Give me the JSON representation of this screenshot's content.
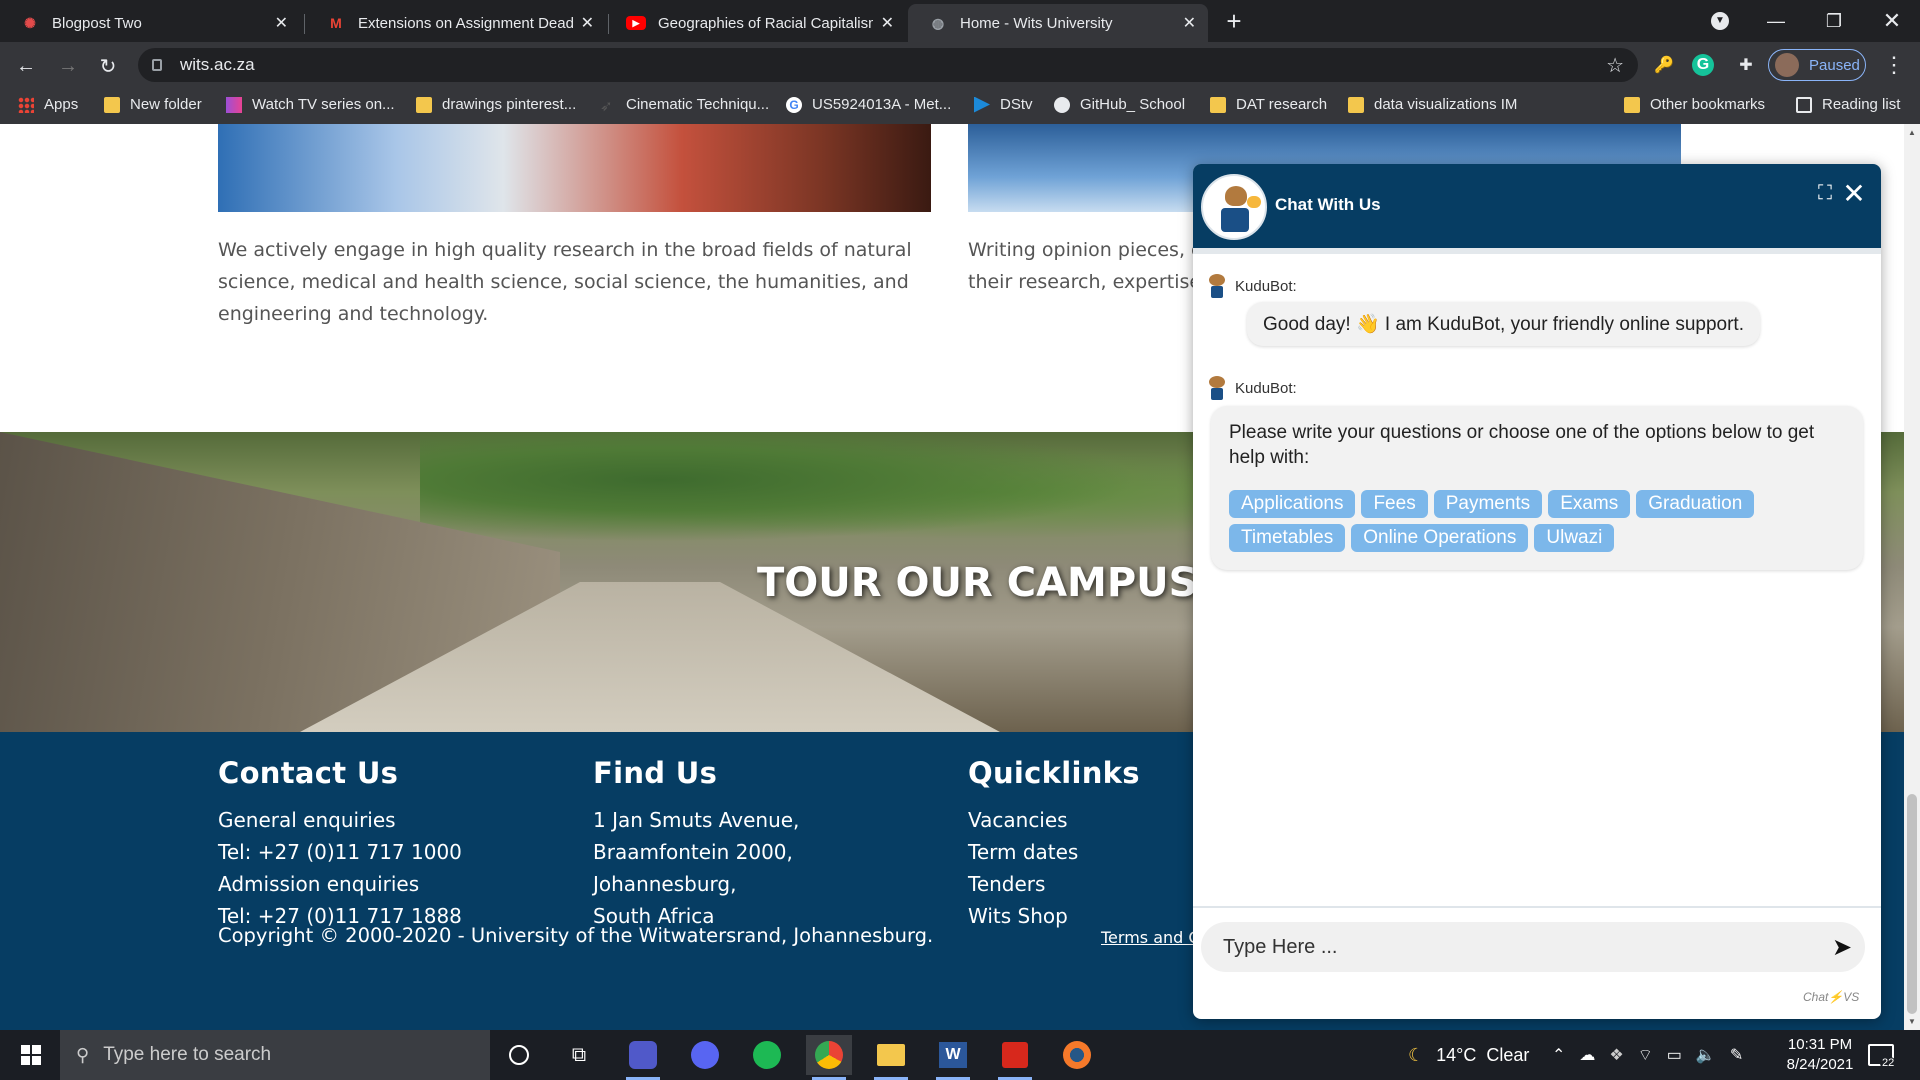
{
  "browser": {
    "tabs": [
      {
        "title": "Blogpost Two",
        "icon": "blogger-icon",
        "color": "#e34b4b"
      },
      {
        "title": "Extensions on Assignment Deadl",
        "icon": "gmail-icon",
        "color": "#ea4335"
      },
      {
        "title": "Geographies of Racial Capitalism",
        "icon": "youtube-icon",
        "color": "#ff0000"
      },
      {
        "title": "Home - Wits University",
        "icon": "globe-icon",
        "color": "#9aa0a6"
      }
    ],
    "url": "wits.ac.za",
    "profile_label": "Paused",
    "bookmarks": [
      {
        "label": "Apps",
        "icon": "apps-grid-icon"
      },
      {
        "label": "New folder",
        "icon": "folder-icon"
      },
      {
        "label": "Watch TV series on...",
        "icon": "tv-icon"
      },
      {
        "label": "drawings pinterest...",
        "icon": "folder-icon"
      },
      {
        "label": "Cinematic Techniqu...",
        "icon": "film-icon"
      },
      {
        "label": "US5924013A - Met...",
        "icon": "google-icon"
      },
      {
        "label": "DStv",
        "icon": "dstv-icon"
      },
      {
        "label": "GitHub_ School",
        "icon": "github-icon"
      },
      {
        "label": "DAT research",
        "icon": "folder-icon"
      },
      {
        "label": "data visualizations IM",
        "icon": "folder-icon"
      },
      {
        "label": "Other bookmarks",
        "icon": "folder-icon"
      },
      {
        "label": "Reading list",
        "icon": "reading-list-icon"
      }
    ]
  },
  "page": {
    "research_text": "We actively engage in high quality research in the broad fields of natural science, medical and health science, social science, the humanities, and engineering and technology.",
    "opinion_text_line1": "Writing opinion pieces, e",
    "opinion_text_line2": "their research, expertise",
    "campus_title": "TOUR OUR CAMPUS",
    "footer": {
      "contact": {
        "heading": "Contact Us",
        "lines": [
          "General enquiries",
          "Tel: +27 (0)11 717 1000",
          "Admission enquiries",
          "Tel: +27 (0)11 717 1888"
        ]
      },
      "find": {
        "heading": "Find Us",
        "lines": [
          "1 Jan Smuts Avenue,",
          "Braamfontein 2000,",
          "Johannesburg,",
          "South Africa"
        ]
      },
      "quick": {
        "heading": "Quicklinks",
        "lines": [
          "Vacancies",
          "Term dates",
          "Tenders",
          "Wits Shop"
        ]
      },
      "copyright": "Copyright © 2000-2020 - University of the Witwatersrand, Johannesburg.",
      "terms": "Terms and C"
    }
  },
  "chat": {
    "title": "Chat With Us",
    "bot_name": "KuduBot:",
    "greeting": "Good day! 👋 I am KuduBot, your friendly online support.",
    "prompt": "Please write your questions or choose one of the options below to get help with:",
    "options": [
      "Applications",
      "Fees",
      "Payments",
      "Exams",
      "Graduation",
      "Timetables",
      "Online Operations",
      "Ulwazi"
    ],
    "input_placeholder": "Type Here ...",
    "powered_by": "Chat⚡VS"
  },
  "taskbar": {
    "search_placeholder": "Type here to search",
    "weather": "14°C  Clear",
    "time": "10:31 PM",
    "date": "8/24/2021",
    "notification_count": "22"
  }
}
